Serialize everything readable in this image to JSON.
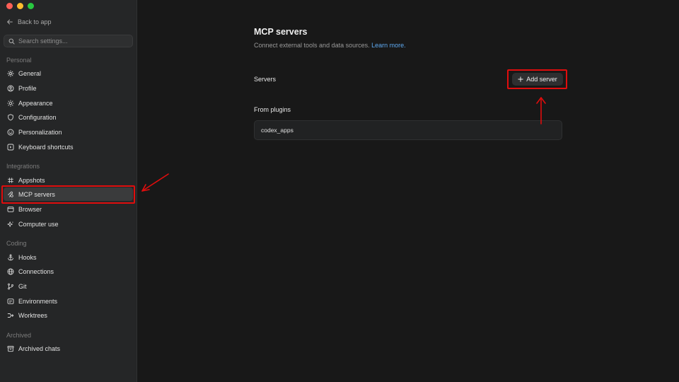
{
  "sidebar": {
    "back_label": "Back to app",
    "search_placeholder": "Search settings...",
    "sections": [
      {
        "label": "Personal",
        "items": [
          {
            "label": "General",
            "icon": "gear-icon"
          },
          {
            "label": "Profile",
            "icon": "user-circle-icon"
          },
          {
            "label": "Appearance",
            "icon": "sun-icon"
          },
          {
            "label": "Configuration",
            "icon": "shield-icon"
          },
          {
            "label": "Personalization",
            "icon": "smile-icon"
          },
          {
            "label": "Keyboard shortcuts",
            "icon": "keyboard-icon"
          }
        ]
      },
      {
        "label": "Integrations",
        "items": [
          {
            "label": "Appshots",
            "icon": "camera-icon"
          },
          {
            "label": "MCP servers",
            "icon": "mcp-icon"
          },
          {
            "label": "Browser",
            "icon": "browser-icon"
          },
          {
            "label": "Computer use",
            "icon": "sparkle-icon"
          }
        ]
      },
      {
        "label": "Coding",
        "items": [
          {
            "label": "Hooks",
            "icon": "anchor-icon"
          },
          {
            "label": "Connections",
            "icon": "globe-icon"
          },
          {
            "label": "Git",
            "icon": "git-branch-icon"
          },
          {
            "label": "Environments",
            "icon": "terminal-icon"
          },
          {
            "label": "Worktrees",
            "icon": "worktree-icon"
          }
        ]
      },
      {
        "label": "Archived",
        "items": [
          {
            "label": "Archived chats",
            "icon": "archive-icon"
          }
        ]
      }
    ],
    "active_item": "MCP servers"
  },
  "main": {
    "title": "MCP servers",
    "subtitle": "Connect external tools and data sources.",
    "learn_more": "Learn more.",
    "servers_label": "Servers",
    "add_server_label": "Add server",
    "from_plugins_label": "From plugins",
    "plugins": [
      {
        "name": "codex_apps"
      }
    ]
  },
  "colors": {
    "annotation": "#e00d0d",
    "link": "#5ea9f0",
    "sidebar_bg": "#252627",
    "main_bg": "#181818"
  }
}
